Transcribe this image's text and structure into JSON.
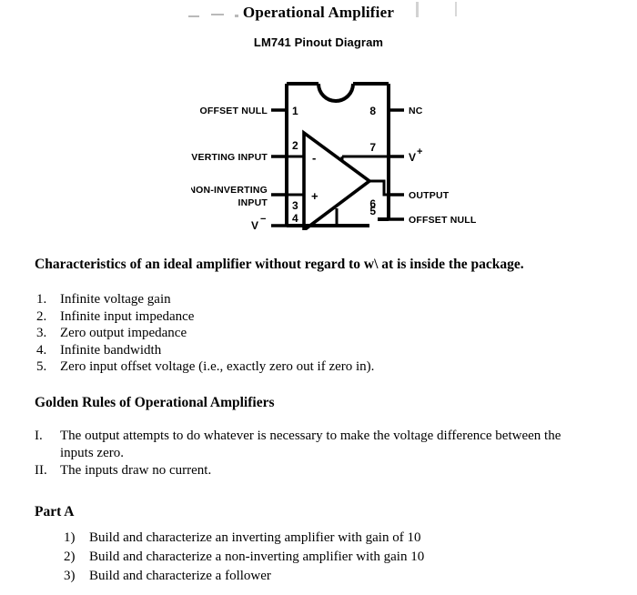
{
  "document": {
    "title": "Operational Amplifier",
    "pinout_caption": "LM741 Pinout Diagram"
  },
  "pinout": {
    "chip": "LM741",
    "package_notch": "semicircle-notch",
    "left_pins": [
      {
        "number": "1",
        "label": "OFFSET NULL"
      },
      {
        "number": "2",
        "label": "INVERTING INPUT"
      },
      {
        "number": "3",
        "label_line1": "NON-INVERTING",
        "label_line2": "INPUT"
      },
      {
        "number": "4",
        "label": "V",
        "superscript": "−"
      }
    ],
    "right_pins": [
      {
        "number": "8",
        "label": "NC"
      },
      {
        "number": "7",
        "label": "V",
        "superscript": "+"
      },
      {
        "number": "6",
        "label": "OUTPUT"
      },
      {
        "number": "5",
        "label": "OFFSET NULL"
      }
    ],
    "opamp_symbol": {
      "inverting_sign": "-",
      "noninverting_sign": "+"
    }
  },
  "characteristics": {
    "heading": "Characteristics of an ideal amplifier without regard to w\\ at is inside the package.",
    "items": [
      {
        "marker": "1.",
        "text": "Infinite voltage gain"
      },
      {
        "marker": "2.",
        "text": "Infinite input impedance"
      },
      {
        "marker": "3.",
        "text": "Zero output impedance"
      },
      {
        "marker": "4.",
        "text": "Infinite bandwidth"
      },
      {
        "marker": "5.",
        "text": "Zero input offset voltage (i.e., exactly zero out if zero in)."
      }
    ]
  },
  "golden_rules": {
    "heading": "Golden Rules of Operational Amplifiers",
    "items": [
      {
        "marker": "I.",
        "text": "The output attempts to do whatever is necessary to make the voltage difference between the inputs zero."
      },
      {
        "marker": "II.",
        "text": "The inputs draw no current."
      }
    ]
  },
  "part_a": {
    "heading": "Part A",
    "items": [
      {
        "marker": "1)",
        "text": "Build and characterize an inverting amplifier with gain of 10"
      },
      {
        "marker": "2)",
        "text": "Build and characterize a non-inverting amplifier with gain 10"
      },
      {
        "marker": "3)",
        "text": "Build and characterize a follower"
      }
    ]
  }
}
